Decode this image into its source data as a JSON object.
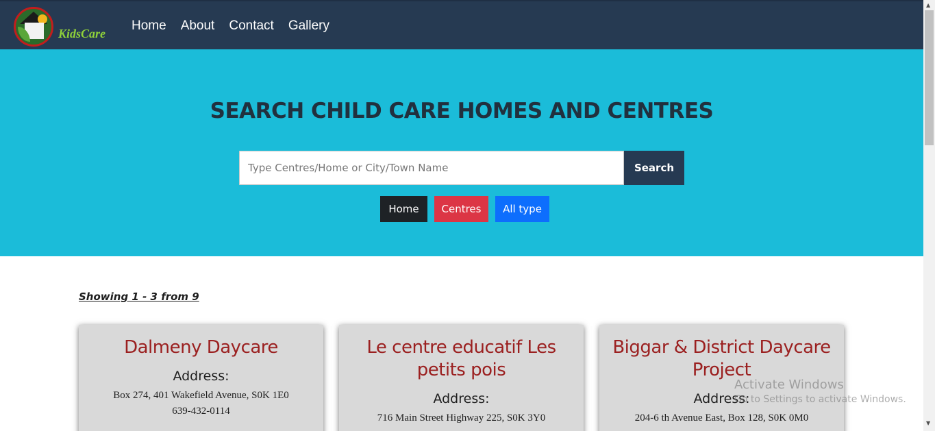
{
  "nav": {
    "brand": "KidsCare",
    "links": [
      "Home",
      "About",
      "Contact",
      "Gallery"
    ]
  },
  "hero": {
    "title": "SEARCH CHILD CARE HOMES AND CENTRES",
    "search_placeholder": "Type Centres/Home or City/Town Name",
    "search_button": "Search",
    "filters": [
      "Home",
      "Centres",
      "All type"
    ]
  },
  "results": {
    "showing": "Showing 1 - 3 from 9",
    "cards": [
      {
        "name": "Dalmeny Daycare",
        "address_label": "Address:",
        "address": "Box 274, 401 Wakefield Avenue, S0K 1E0",
        "phone": "639-432-0114"
      },
      {
        "name": "Le centre educatif Les petits pois",
        "address_label": "Address:",
        "address": "716 Main Street Highway 225, S0K 3Y0"
      },
      {
        "name": "Biggar & District Daycare Project",
        "address_label": "Address:",
        "address": "204-6 th Avenue East, Box 128, S0K 0M0"
      }
    ]
  },
  "watermark": {
    "title": "Activate Windows",
    "subtitle": "Go to Settings to activate Windows."
  },
  "colors": {
    "navbar": "#263a52",
    "hero": "#1bbcd9",
    "card_title": "#9b2020",
    "filter_home": "#1e2226",
    "filter_centres": "#dc3545",
    "filter_all": "#0d6efd"
  }
}
